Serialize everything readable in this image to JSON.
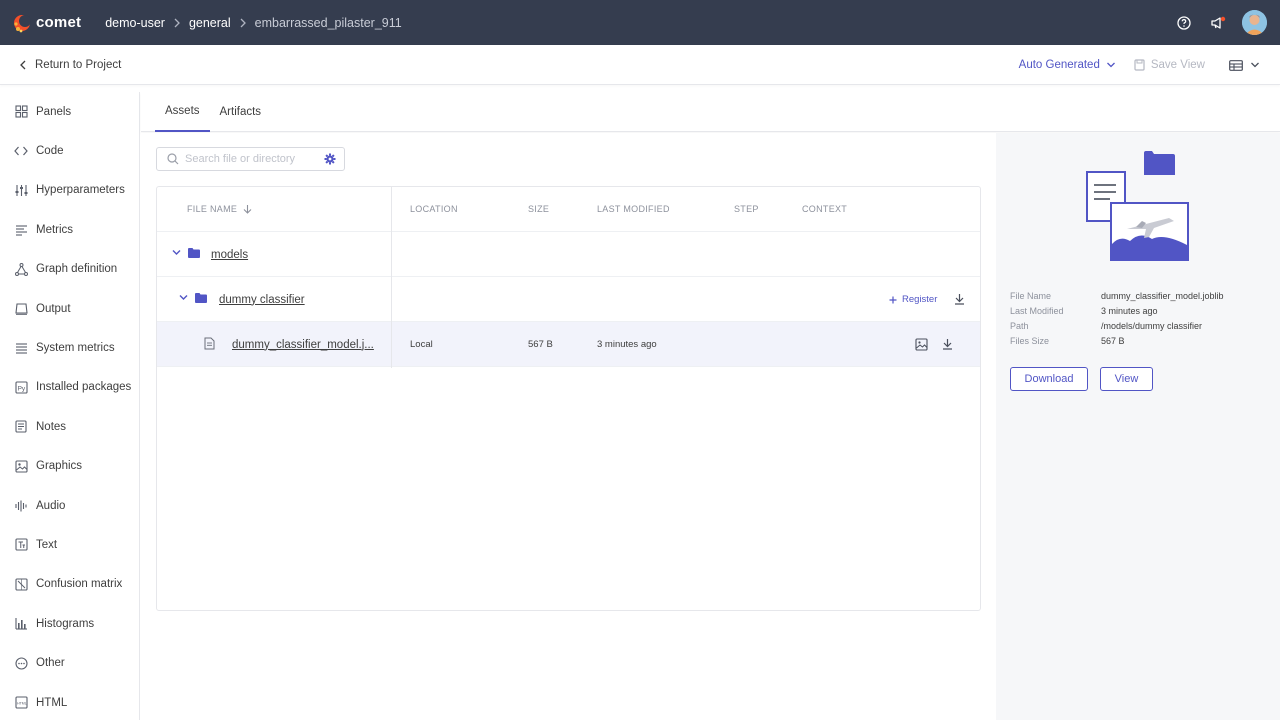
{
  "topbar": {
    "brand": "comet",
    "breadcrumbs": [
      "demo-user",
      "general",
      "embarrassed_pilaster_911"
    ]
  },
  "subheader": {
    "back_label": "Return to Project",
    "view_select_label": "Auto Generated",
    "save_view_label": "Save View"
  },
  "sidebar": {
    "items": [
      {
        "label": "Panels",
        "icon": "panels-icon"
      },
      {
        "label": "Code",
        "icon": "code-icon"
      },
      {
        "label": "Hyperparameters",
        "icon": "hyperparameters-icon"
      },
      {
        "label": "Metrics",
        "icon": "metrics-icon"
      },
      {
        "label": "Graph definition",
        "icon": "graph-icon"
      },
      {
        "label": "Output",
        "icon": "output-icon"
      },
      {
        "label": "System metrics",
        "icon": "system-metrics-icon"
      },
      {
        "label": "Installed packages",
        "icon": "python-icon"
      },
      {
        "label": "Notes",
        "icon": "notes-icon"
      },
      {
        "label": "Graphics",
        "icon": "image-icon"
      },
      {
        "label": "Audio",
        "icon": "audio-icon"
      },
      {
        "label": "Text",
        "icon": "text-icon"
      },
      {
        "label": "Confusion matrix",
        "icon": "matrix-icon"
      },
      {
        "label": "Histograms",
        "icon": "histogram-icon"
      },
      {
        "label": "Other",
        "icon": "other-icon"
      },
      {
        "label": "HTML",
        "icon": "html-icon"
      }
    ]
  },
  "tabs": {
    "assets": "Assets",
    "artifacts": "Artifacts"
  },
  "search": {
    "placeholder": "Search file or directory"
  },
  "table": {
    "headers": {
      "file_name": "FILE NAME",
      "location": "LOCATION",
      "size": "SIZE",
      "last_modified": "LAST MODIFIED",
      "step": "STEP",
      "context": "CONTEXT"
    },
    "rows": [
      {
        "name": "models",
        "type": "folder"
      },
      {
        "name": "dummy classifier",
        "type": "folder",
        "action": "Register"
      },
      {
        "name": "dummy_classifier_model.j...",
        "type": "file",
        "location": "Local",
        "size": "567 B",
        "last_modified": "3 minutes ago"
      }
    ]
  },
  "details": {
    "labels": {
      "file_name": "File Name",
      "last_modified": "Last Modified",
      "path": "Path",
      "files_size": "Files Size"
    },
    "values": {
      "file_name": "dummy_classifier_model.joblib",
      "last_modified": "3 minutes ago",
      "path": "/models/dummy classifier",
      "files_size": "567 B"
    },
    "download_label": "Download",
    "view_label": "View"
  },
  "colors": {
    "topbar": "#353d4f",
    "accent": "#5155c5",
    "folder": "#5155c5",
    "highlight_row": "#f2f3fb",
    "panel_bg": "#f6f7f9"
  }
}
